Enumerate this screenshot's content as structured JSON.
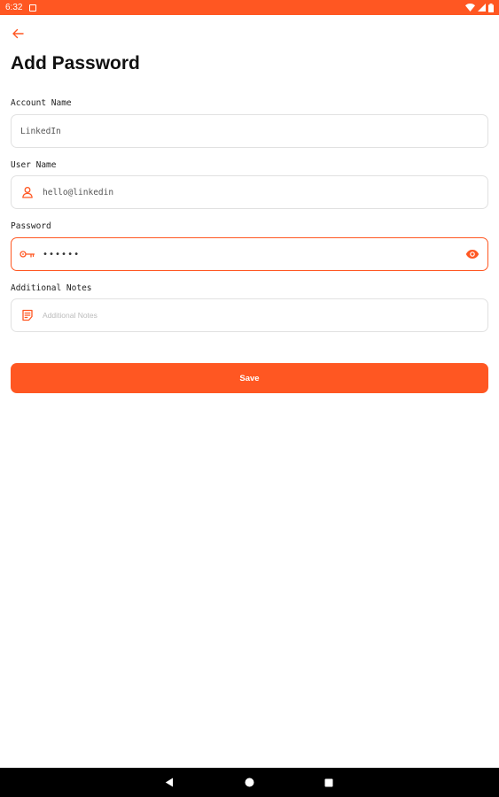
{
  "status_bar": {
    "time": "6:32"
  },
  "header": {
    "title": "Add Password"
  },
  "fields": {
    "account_name": {
      "label": "Account Name",
      "value": "LinkedIn",
      "placeholder": "Account Name"
    },
    "user_name": {
      "label": "User Name",
      "value": "hello@linkedin",
      "placeholder": "User Name"
    },
    "password": {
      "label": "Password",
      "value": "••••••",
      "state": "focused"
    },
    "notes": {
      "label": "Additional Notes",
      "value": "",
      "placeholder": "Additional Notes"
    }
  },
  "actions": {
    "save_label": "Save"
  },
  "colors": {
    "accent": "#ff5722",
    "background": "#ffffff",
    "navbar": "#000000"
  },
  "icons": [
    "arrow-left-icon",
    "user-icon",
    "key-icon",
    "eye-icon",
    "notes-icon",
    "wifi-icon",
    "battery-icon",
    "nav-back-icon",
    "nav-home-icon",
    "nav-recents-icon"
  ]
}
